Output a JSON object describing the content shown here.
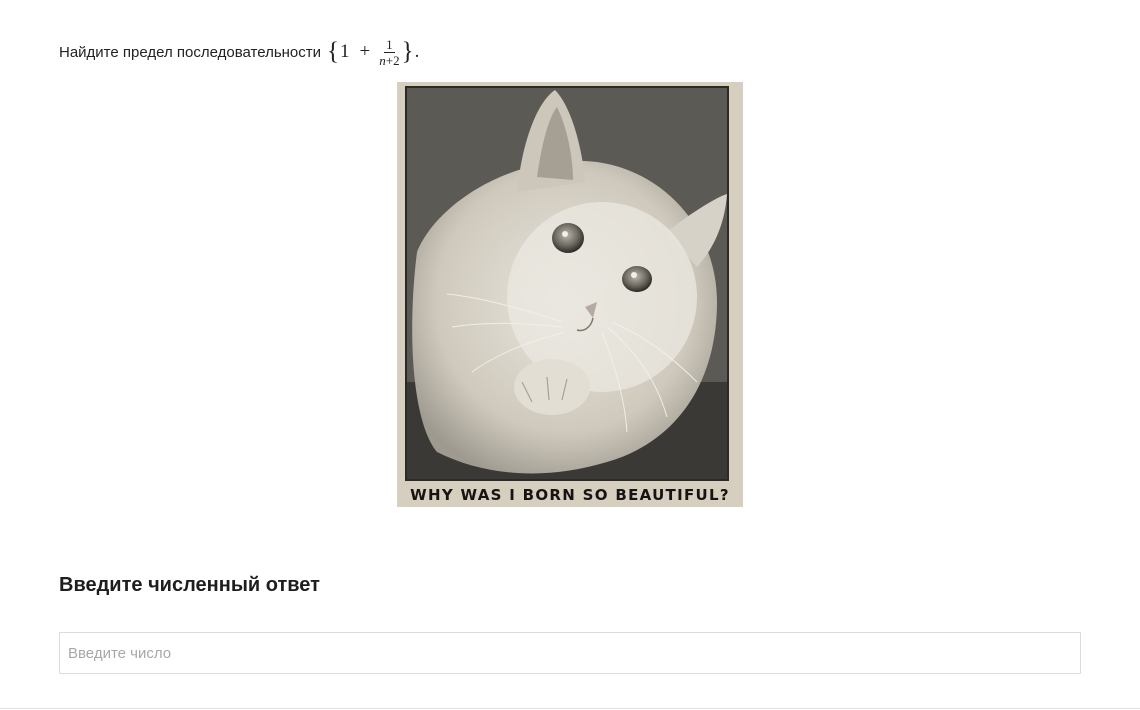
{
  "question": {
    "text": "Найдите предел последовательности",
    "formula": {
      "open_brace": "{",
      "one": "1",
      "plus": "+",
      "numerator": "1",
      "denominator_var": "n",
      "denominator_rest": "+2",
      "close_brace": "}",
      "period": "."
    }
  },
  "picture": {
    "caption": "WHY WAS I BORN SO BEAUTIFUL?"
  },
  "answer": {
    "heading": "Введите численный ответ",
    "placeholder": "Введите число",
    "value": ""
  }
}
